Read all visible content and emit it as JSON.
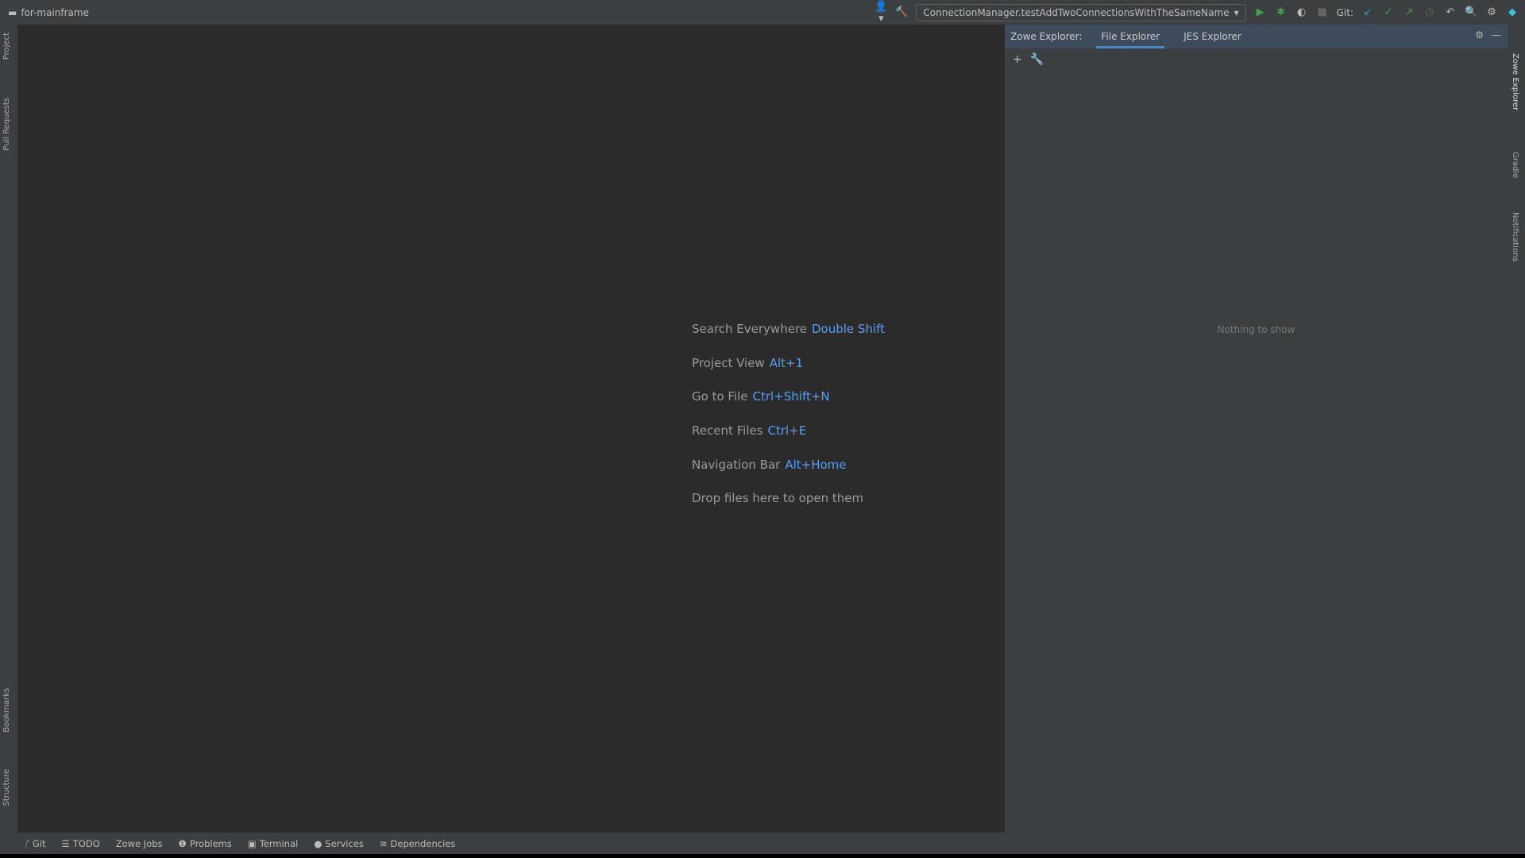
{
  "title": {
    "project": "for-mainframe"
  },
  "toolbar": {
    "run_config": "ConnectionManager.testAddTwoConnectionsWithTheSameName",
    "git_label": "Git:"
  },
  "left_strip": [
    "Project",
    "Pull Requests",
    "Bookmarks",
    "Structure"
  ],
  "right_strip": [
    "Zowe Explorer",
    "Gradle",
    "Notifications"
  ],
  "editor": {
    "hints": [
      {
        "label": "Search Everywhere",
        "key": "Double Shift"
      },
      {
        "label": "Project View",
        "key": "Alt+1"
      },
      {
        "label": "Go to File",
        "key": "Ctrl+Shift+N"
      },
      {
        "label": "Recent Files",
        "key": "Ctrl+E"
      },
      {
        "label": "Navigation Bar",
        "key": "Alt+Home"
      },
      {
        "label": "Drop files here to open them",
        "key": ""
      }
    ]
  },
  "panel": {
    "title": "Zowe Explorer:",
    "tabs": [
      "File Explorer",
      "JES Explorer"
    ],
    "active_tab": "File Explorer",
    "empty": "Nothing to show"
  },
  "bottom": [
    "Git",
    "TODO",
    "Zowe Jobs",
    "Problems",
    "Terminal",
    "Services",
    "Dependencies"
  ],
  "colors": {
    "accent": "#589df6",
    "run": "#499c54"
  }
}
